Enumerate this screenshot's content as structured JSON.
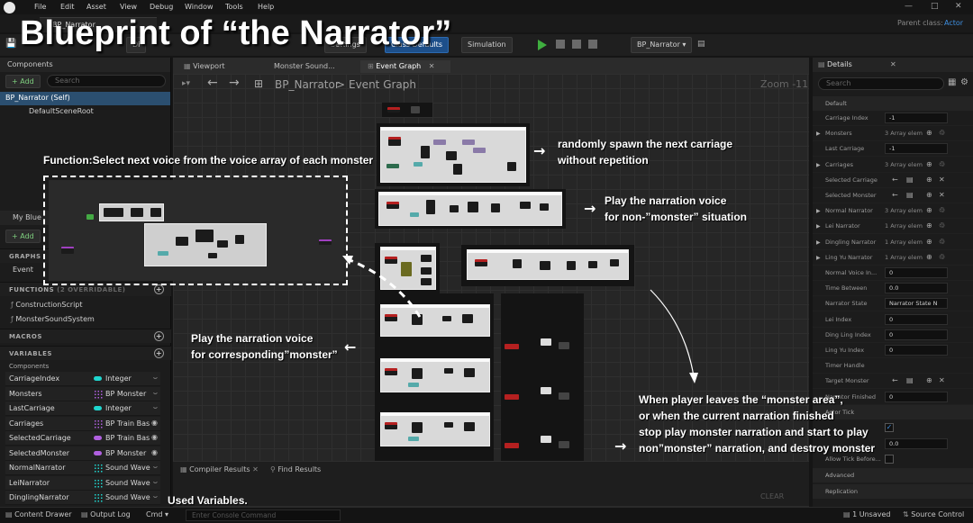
{
  "title": "Blueprint of “the Narrator”",
  "menu": [
    "File",
    "Edit",
    "Asset",
    "View",
    "Debug",
    "Window",
    "Tools",
    "Help"
  ],
  "doc_tab": "BP_Narrator",
  "parent_class": {
    "label": "Parent class:",
    "value": "Actor"
  },
  "toolbar": {
    "settings": "Settings",
    "class_defaults": "Class Defaults",
    "simulation": "Simulation",
    "debug_object": "BP_Narrator ▾",
    "diff": "Di"
  },
  "components": {
    "header": "Components",
    "add": "+ Add",
    "search_placeholder": "Search",
    "items": [
      "BP_Narrator (Self)",
      "DefaultSceneRoot"
    ]
  },
  "my_blueprint": {
    "header": "My Blue",
    "add": "+ Add",
    "graphs_label": "GRAPHS",
    "event_graph": "Event",
    "functions_label": "FUNCTIONS",
    "functions_count": "(2 OVERRIDABLE)",
    "functions": [
      "ConstructionScript",
      "MonsterSoundSystem"
    ],
    "macros_label": "MACROS",
    "variables_label": "VARIABLES",
    "components_label": "Components",
    "variables": [
      {
        "name": "CarriageIndex",
        "type": "Integer",
        "kind": "pill",
        "color": "#1fd6cf"
      },
      {
        "name": "Monsters",
        "type": "BP Monster",
        "kind": "grid",
        "color": "#b060e0"
      },
      {
        "name": "LastCarriage",
        "type": "Integer",
        "kind": "pill",
        "color": "#1fd6cf"
      },
      {
        "name": "Carriages",
        "type": "BP Train Bas",
        "kind": "grid",
        "color": "#b060e0"
      },
      {
        "name": "SelectedCarriage",
        "type": "BP Train Bas",
        "kind": "pill",
        "color": "#b060e0"
      },
      {
        "name": "SelectedMonster",
        "type": "BP Monster",
        "kind": "pill",
        "color": "#b060e0"
      },
      {
        "name": "NormalNarrator",
        "type": "Sound Wave",
        "kind": "grid",
        "color": "#1fd6cf"
      },
      {
        "name": "LeiNarrator",
        "type": "Sound Wave",
        "kind": "grid",
        "color": "#1fd6cf"
      },
      {
        "name": "DinglingNarrator",
        "type": "Sound Wave",
        "kind": "grid",
        "color": "#1fd6cf"
      }
    ]
  },
  "graph": {
    "tabs": [
      "Viewport",
      "Monster Sound...",
      "Event Graph"
    ],
    "breadcrumb_root": "BP_Narrator",
    "breadcrumb_sep": ">",
    "breadcrumb_leaf": "Event Graph",
    "zoom": "Zoom -11",
    "bottom_tabs": [
      "Compiler Results",
      "Find Results"
    ],
    "clear": "CLEAR"
  },
  "details": {
    "header": "Details",
    "search_placeholder": "Search",
    "default_section": "Default",
    "rows": [
      {
        "label": "Carriage Index",
        "value": "-1",
        "kind": "field"
      },
      {
        "label": "Monsters",
        "value": "3 Array elem",
        "kind": "text"
      },
      {
        "label": "Last Carriage",
        "value": "-1",
        "kind": "field"
      },
      {
        "label": "Carriages",
        "value": "3 Array elem",
        "kind": "text"
      },
      {
        "label": "Selected Carriage",
        "value": "",
        "kind": "icons"
      },
      {
        "label": "Selected Monster",
        "value": "",
        "kind": "icons"
      },
      {
        "label": "Normal Narrator",
        "value": "3 Array elem",
        "kind": "text"
      },
      {
        "label": "Lei Narrator",
        "value": "1 Array elem",
        "kind": "text"
      },
      {
        "label": "Dingling Narrator",
        "value": "1 Array elem",
        "kind": "text"
      },
      {
        "label": "Ling Yu Narrator",
        "value": "1 Array elem",
        "kind": "text"
      },
      {
        "label": "Normal Voice In...",
        "value": "0",
        "kind": "field"
      },
      {
        "label": "Time Between",
        "value": "0.0",
        "kind": "field"
      },
      {
        "label": "Narrator State",
        "value": "Narrator State N",
        "kind": "field"
      },
      {
        "label": "Lei Index",
        "value": "0",
        "kind": "field"
      },
      {
        "label": "Ding Ling Index",
        "value": "0",
        "kind": "field"
      },
      {
        "label": "Ling Yu Index",
        "value": "0",
        "kind": "field"
      },
      {
        "label": "Timer Handle",
        "value": "",
        "kind": "text"
      },
      {
        "label": "Target Monster",
        "value": "",
        "kind": "icons"
      },
      {
        "label": "Narrator Finished",
        "value": "0",
        "kind": "field"
      }
    ],
    "actor_tick": "Actor Tick",
    "tick_interval": "0.0",
    "allow_tick": "Allow Tick Before...",
    "advanced": "Advanced",
    "replication": "Replication"
  },
  "statusbar": {
    "content_drawer": "Content Drawer",
    "output_log": "Output Log",
    "cmd": "Cmd ▾",
    "console_placeholder": "Enter Console Command",
    "unsaved": "1 Unsaved",
    "source_control": "Source Control"
  },
  "annotations": {
    "function": "Function:Select next voice from the voice array of each monster",
    "random_1": "randomly spawn the next carriage",
    "random_2": "without repetition",
    "nonmonster_1": "Play the narration voice",
    "nonmonster_2": "for non-”monster” situation",
    "monster_1": "Play the narration voice",
    "monster_2": "for corresponding”monster”",
    "leave_1": "When player leaves the “monster area”,",
    "leave_2": "or when the current narration finished",
    "leave_3": "stop play monster narration and start to play",
    "leave_4": "non”monster” narration, and destroy monster",
    "used_vars": "Used Variables."
  }
}
